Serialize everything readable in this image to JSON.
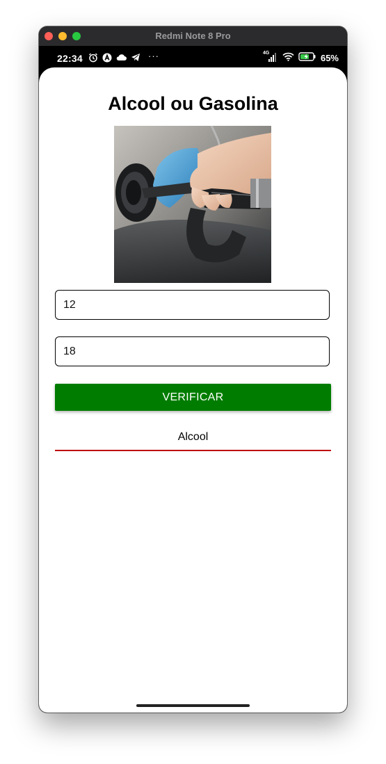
{
  "window": {
    "title": "Redmi Note 8 Pro"
  },
  "status_bar": {
    "time": "22:34",
    "network": "4G",
    "battery_percent": "65%",
    "icons": [
      "alarm-icon",
      "app-a-icon",
      "cloud-icon",
      "telegram-icon",
      "more-dots-icon",
      "signal-icon",
      "wifi-icon",
      "battery-charging-icon"
    ],
    "more": "···"
  },
  "app": {
    "title": "Alcool ou Gasolina",
    "image": "fuel-pump-nozzle-photo",
    "alcool_input": {
      "value": "12"
    },
    "gasolina_input": {
      "value": "18"
    },
    "verify_label": "VERIFICAR",
    "result": "Alcool"
  },
  "colors": {
    "button": "#007d00",
    "result_underline": "#c00000"
  }
}
